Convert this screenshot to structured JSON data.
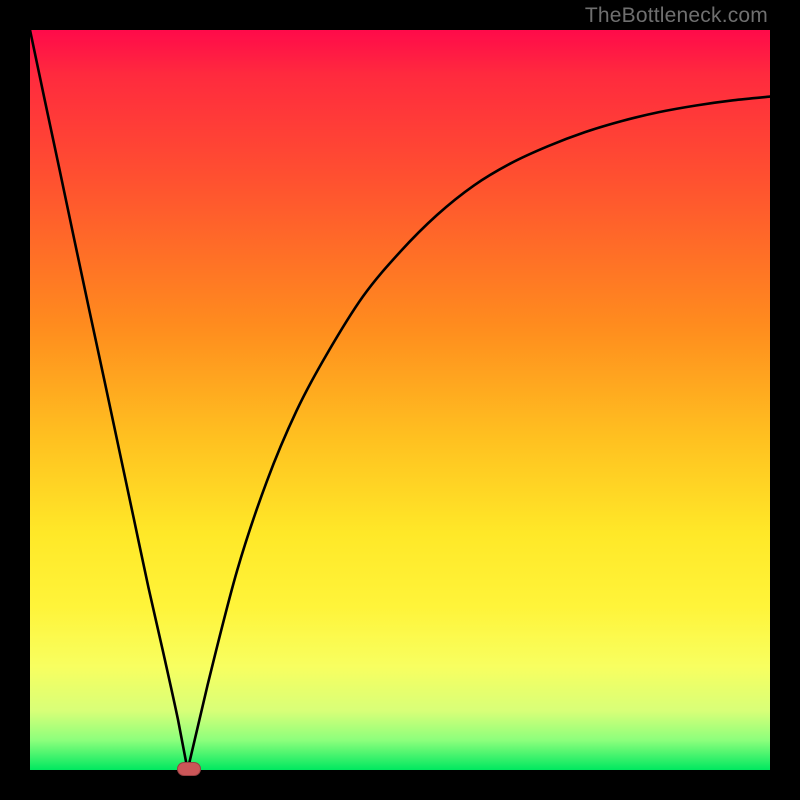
{
  "watermark": "TheBottleneck.com",
  "colors": {
    "frame": "#000000",
    "gradient_top": "#ff0a4a",
    "gradient_bottom": "#00e860",
    "curve": "#000000",
    "marker": "#cb5658"
  },
  "chart_data": {
    "type": "line",
    "title": "",
    "xlabel": "",
    "ylabel": "",
    "xlim": [
      0,
      1
    ],
    "ylim": [
      0,
      1
    ],
    "x": [
      0.0,
      0.02,
      0.04,
      0.06,
      0.08,
      0.1,
      0.12,
      0.14,
      0.16,
      0.18,
      0.2,
      0.213,
      0.24,
      0.28,
      0.32,
      0.36,
      0.4,
      0.45,
      0.5,
      0.55,
      0.6,
      0.65,
      0.7,
      0.75,
      0.8,
      0.85,
      0.9,
      0.95,
      1.0
    ],
    "values": [
      1.0,
      0.905,
      0.811,
      0.716,
      0.622,
      0.529,
      0.435,
      0.341,
      0.247,
      0.159,
      0.068,
      0.0,
      0.115,
      0.27,
      0.39,
      0.485,
      0.56,
      0.64,
      0.7,
      0.75,
      0.79,
      0.82,
      0.843,
      0.862,
      0.877,
      0.889,
      0.898,
      0.905,
      0.91
    ],
    "marker": {
      "x": 0.213,
      "y": 0.0
    },
    "notes": "No axis ticks or numeric labels visible; values are normalized 0–1 estimates read from pixel positions."
  }
}
